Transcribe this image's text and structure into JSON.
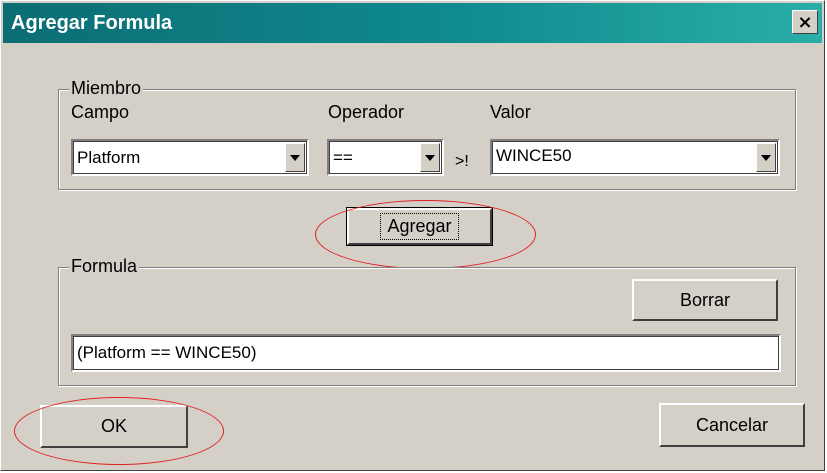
{
  "window": {
    "title": "Agregar Formula",
    "close_glyph": "×"
  },
  "miembro": {
    "group_label": "Miembro",
    "campo": {
      "label": "Campo",
      "value": "Platform"
    },
    "operador": {
      "label": "Operador",
      "value": "=="
    },
    "hint": ">!",
    "valor": {
      "label": "Valor",
      "value": "WINCE50"
    }
  },
  "agregar_button": "Agregar",
  "formula": {
    "group_label": "Formula",
    "borrar_button": "Borrar",
    "value": "(Platform == WINCE50)"
  },
  "ok_button": "OK",
  "cancelar_button": "Cancelar",
  "annotation_color": "#e02020"
}
